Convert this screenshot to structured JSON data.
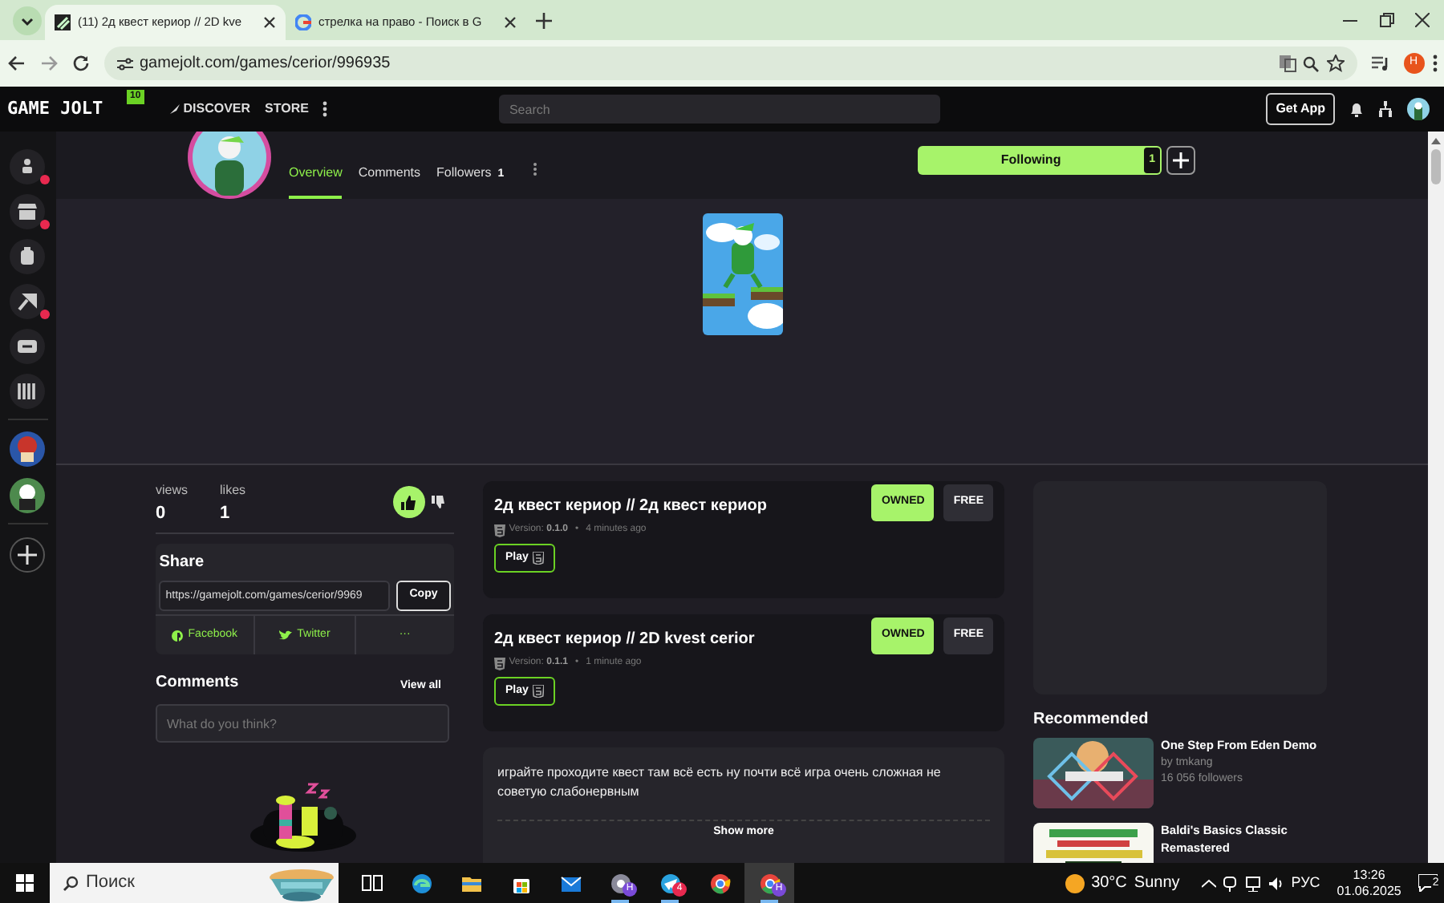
{
  "browser": {
    "tabs": [
      {
        "title": "(11) 2д квест кериор // 2D kve",
        "kind": "gamejolt",
        "selected": true
      },
      {
        "title": "стрелка на право - Поиск в G",
        "kind": "google",
        "selected": false
      }
    ],
    "url": "gamejolt.com/games/cerior/996935",
    "profile_initial": "H"
  },
  "site_nav": {
    "logo": "GAME JOLT",
    "logo_count": "10",
    "links": [
      "DISCOVER",
      "STORE"
    ],
    "search_placeholder": "Search",
    "get_app": "Get App"
  },
  "sidebar": {
    "items": [
      {
        "kind": "nav",
        "alert": true
      },
      {
        "kind": "nav",
        "alert": true
      },
      {
        "kind": "nav",
        "alert": false
      },
      {
        "kind": "nav",
        "alert": true
      },
      {
        "kind": "nav",
        "alert": false
      },
      {
        "kind": "nav",
        "alert": false
      },
      {
        "kind": "community"
      },
      {
        "kind": "community"
      },
      {
        "kind": "add"
      }
    ]
  },
  "profile_tabs": [
    {
      "label": "Overview",
      "selected": true
    },
    {
      "label": "Comments",
      "selected": false
    },
    {
      "label": "Followers",
      "count": "1",
      "selected": false
    }
  ],
  "follow": {
    "label": "Following",
    "count": "1",
    "following": true
  },
  "stats": [
    {
      "label": "views",
      "value": "0"
    },
    {
      "label": "likes",
      "value": "1"
    }
  ],
  "liked": true,
  "share": {
    "title": "Share",
    "url": "https://gamejolt.com/games/cerior/9969",
    "copy": "Copy",
    "networks": [
      {
        "kind": "facebook",
        "label": "Facebook"
      },
      {
        "kind": "twitter",
        "label": "Twitter"
      },
      {
        "kind": "more",
        "label": "···"
      }
    ]
  },
  "comments": {
    "title": "Comments",
    "view_all": "View all",
    "placeholder": "What do you think?"
  },
  "builds": [
    {
      "title": "2д квест кериор // 2д квест кериор",
      "version_label": "Version:",
      "version": "0.1.0",
      "separator": "•",
      "time": "4 minutes ago",
      "play": "Play",
      "badges": [
        {
          "label": "OWNED",
          "kind": "owned"
        },
        {
          "label": "FREE",
          "kind": "price"
        }
      ]
    },
    {
      "title": "2д квест кериор // 2D kvest cerior",
      "version_label": "Version:",
      "version": "0.1.1",
      "separator": "•",
      "time": "1 minute ago",
      "play": "Play",
      "badges": [
        {
          "label": "OWNED",
          "kind": "owned"
        },
        {
          "label": "FREE",
          "kind": "price"
        }
      ]
    }
  ],
  "description": {
    "text": "играйте проходите квест там всё есть ну почти всё игра очень сложная не советую слабонервным",
    "show_more": "Show more"
  },
  "recommended": {
    "title": "Recommended",
    "items": [
      {
        "title": "One Step From Eden Demo",
        "author_prefix": "by",
        "author": "tmkang",
        "followers": "16 056 followers",
        "kind": "picture"
      },
      {
        "title": "Baldi's Basics Classic Remastered",
        "kind": "picture"
      }
    ]
  },
  "taskbar": {
    "search_placeholder": "Поиск",
    "apps": [
      {
        "kind": "taskview",
        "running": false,
        "selected": false
      },
      {
        "kind": "edge",
        "running": false,
        "selected": false
      },
      {
        "kind": "folder",
        "running": false,
        "selected": false
      },
      {
        "kind": "store",
        "running": false,
        "selected": false
      },
      {
        "kind": "mail",
        "running": false,
        "selected": false
      },
      {
        "kind": "chrome_grey",
        "badge": "H",
        "running": true,
        "selected": false
      },
      {
        "kind": "telegram",
        "badge": "4",
        "running": true,
        "selected": false
      },
      {
        "kind": "chrome",
        "running": false,
        "selected": false
      },
      {
        "kind": "chrome",
        "badge": "H",
        "running": true,
        "selected": true
      }
    ],
    "weather": {
      "temp": "30°C",
      "condition": "Sunny"
    },
    "language": "РУС",
    "time": "13:26",
    "date": "01.06.2025",
    "notifications": "2"
  }
}
